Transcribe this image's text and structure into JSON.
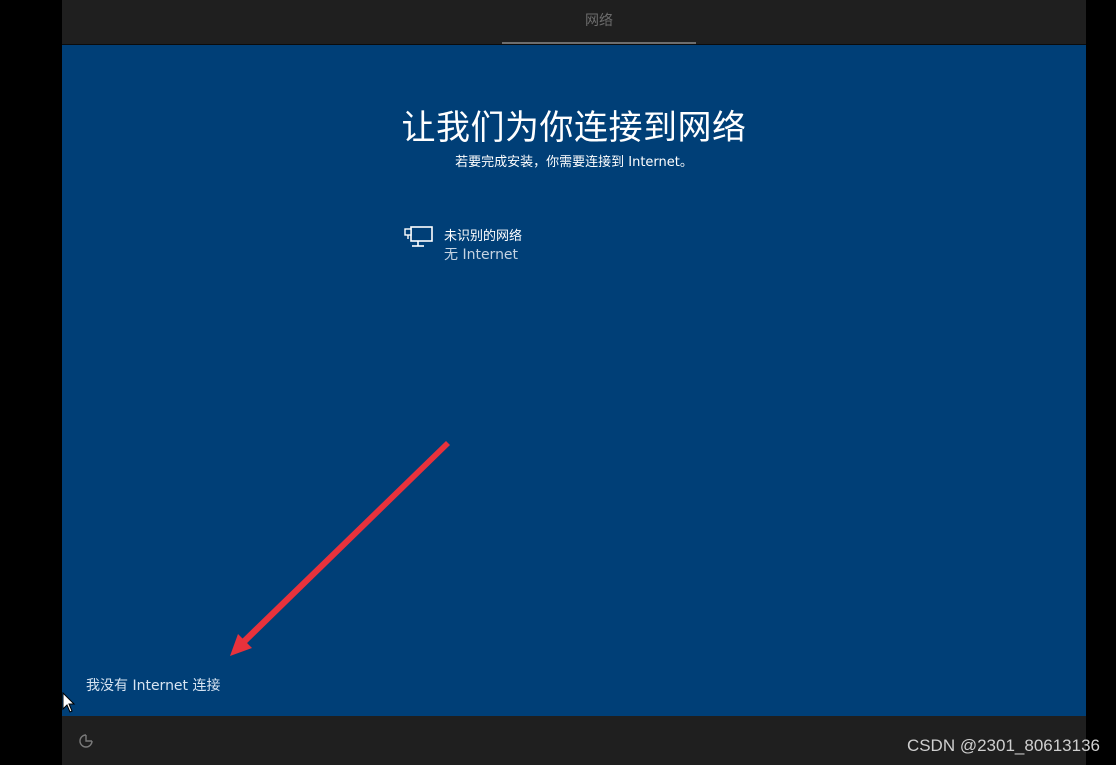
{
  "header": {
    "tab_label": "网络"
  },
  "main": {
    "title": "让我们为你连接到网络",
    "subtitle": "若要完成安装，你需要连接到 Internet。",
    "network": {
      "name": "未识别的网络",
      "status": "无 Internet",
      "icon": "wired-network-icon"
    },
    "no_internet_link": "我没有 Internet 连接"
  },
  "footer": {
    "ease_of_access_icon": "ease-of-access-icon"
  },
  "watermark": "CSDN @2301_80613136",
  "colors": {
    "main_background": "#003f77",
    "bar_background": "#1f1f1f",
    "annotation_arrow": "#e8323c"
  }
}
